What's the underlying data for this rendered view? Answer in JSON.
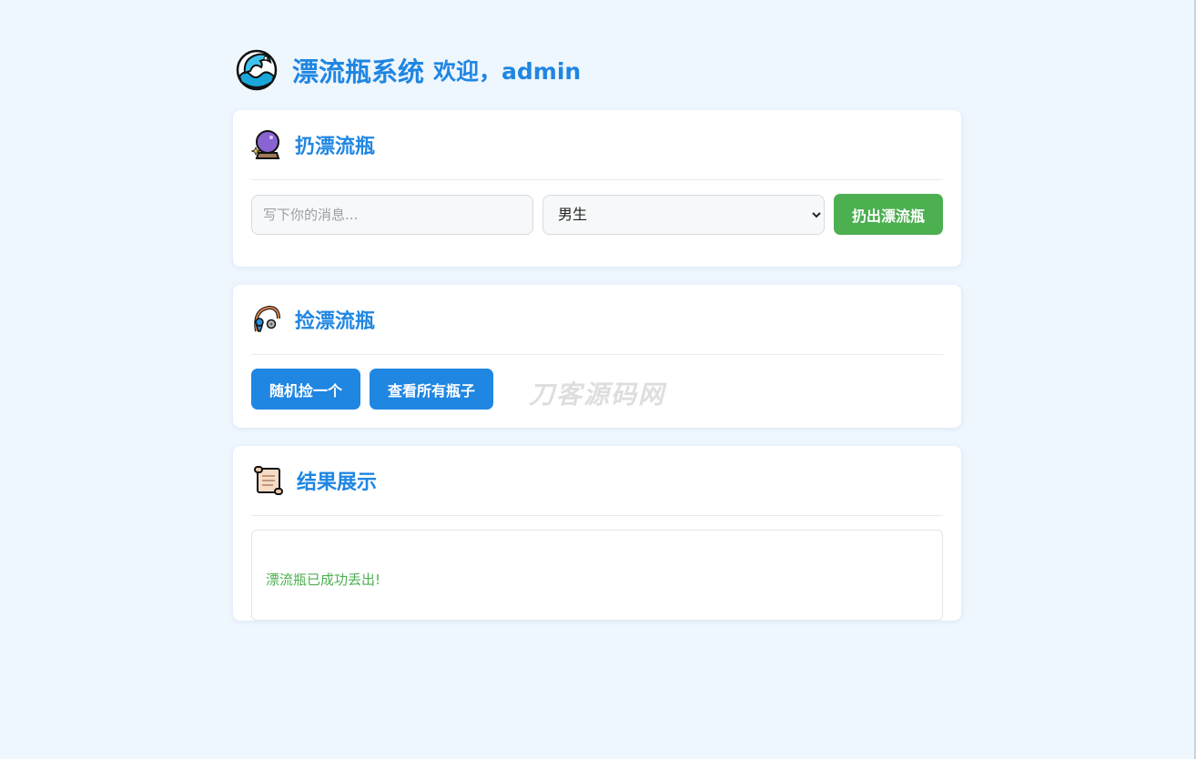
{
  "header": {
    "logo_icon": "wave-icon",
    "title": "漂流瓶系统",
    "welcome": "欢迎，admin"
  },
  "throw_section": {
    "icon": "crystal-ball-icon",
    "heading": "扔漂流瓶",
    "message_placeholder": "写下你的消息...",
    "message_value": "",
    "gender_selected": "男生",
    "gender_options": [
      "男生"
    ],
    "throw_button": "扔出漂流瓶",
    "button_color": "#4caf50"
  },
  "pick_section": {
    "icon": "fishing-pole-icon",
    "heading": "捡漂流瓶",
    "random_button": "随机捡一个",
    "view_all_button": "查看所有瓶子",
    "button_color": "#1f86e2"
  },
  "watermark": "刀客源码网",
  "result_section": {
    "icon": "scroll-icon",
    "heading": "结果展示",
    "message": "漂流瓶已成功丢出!",
    "message_color": "#4caf50"
  }
}
